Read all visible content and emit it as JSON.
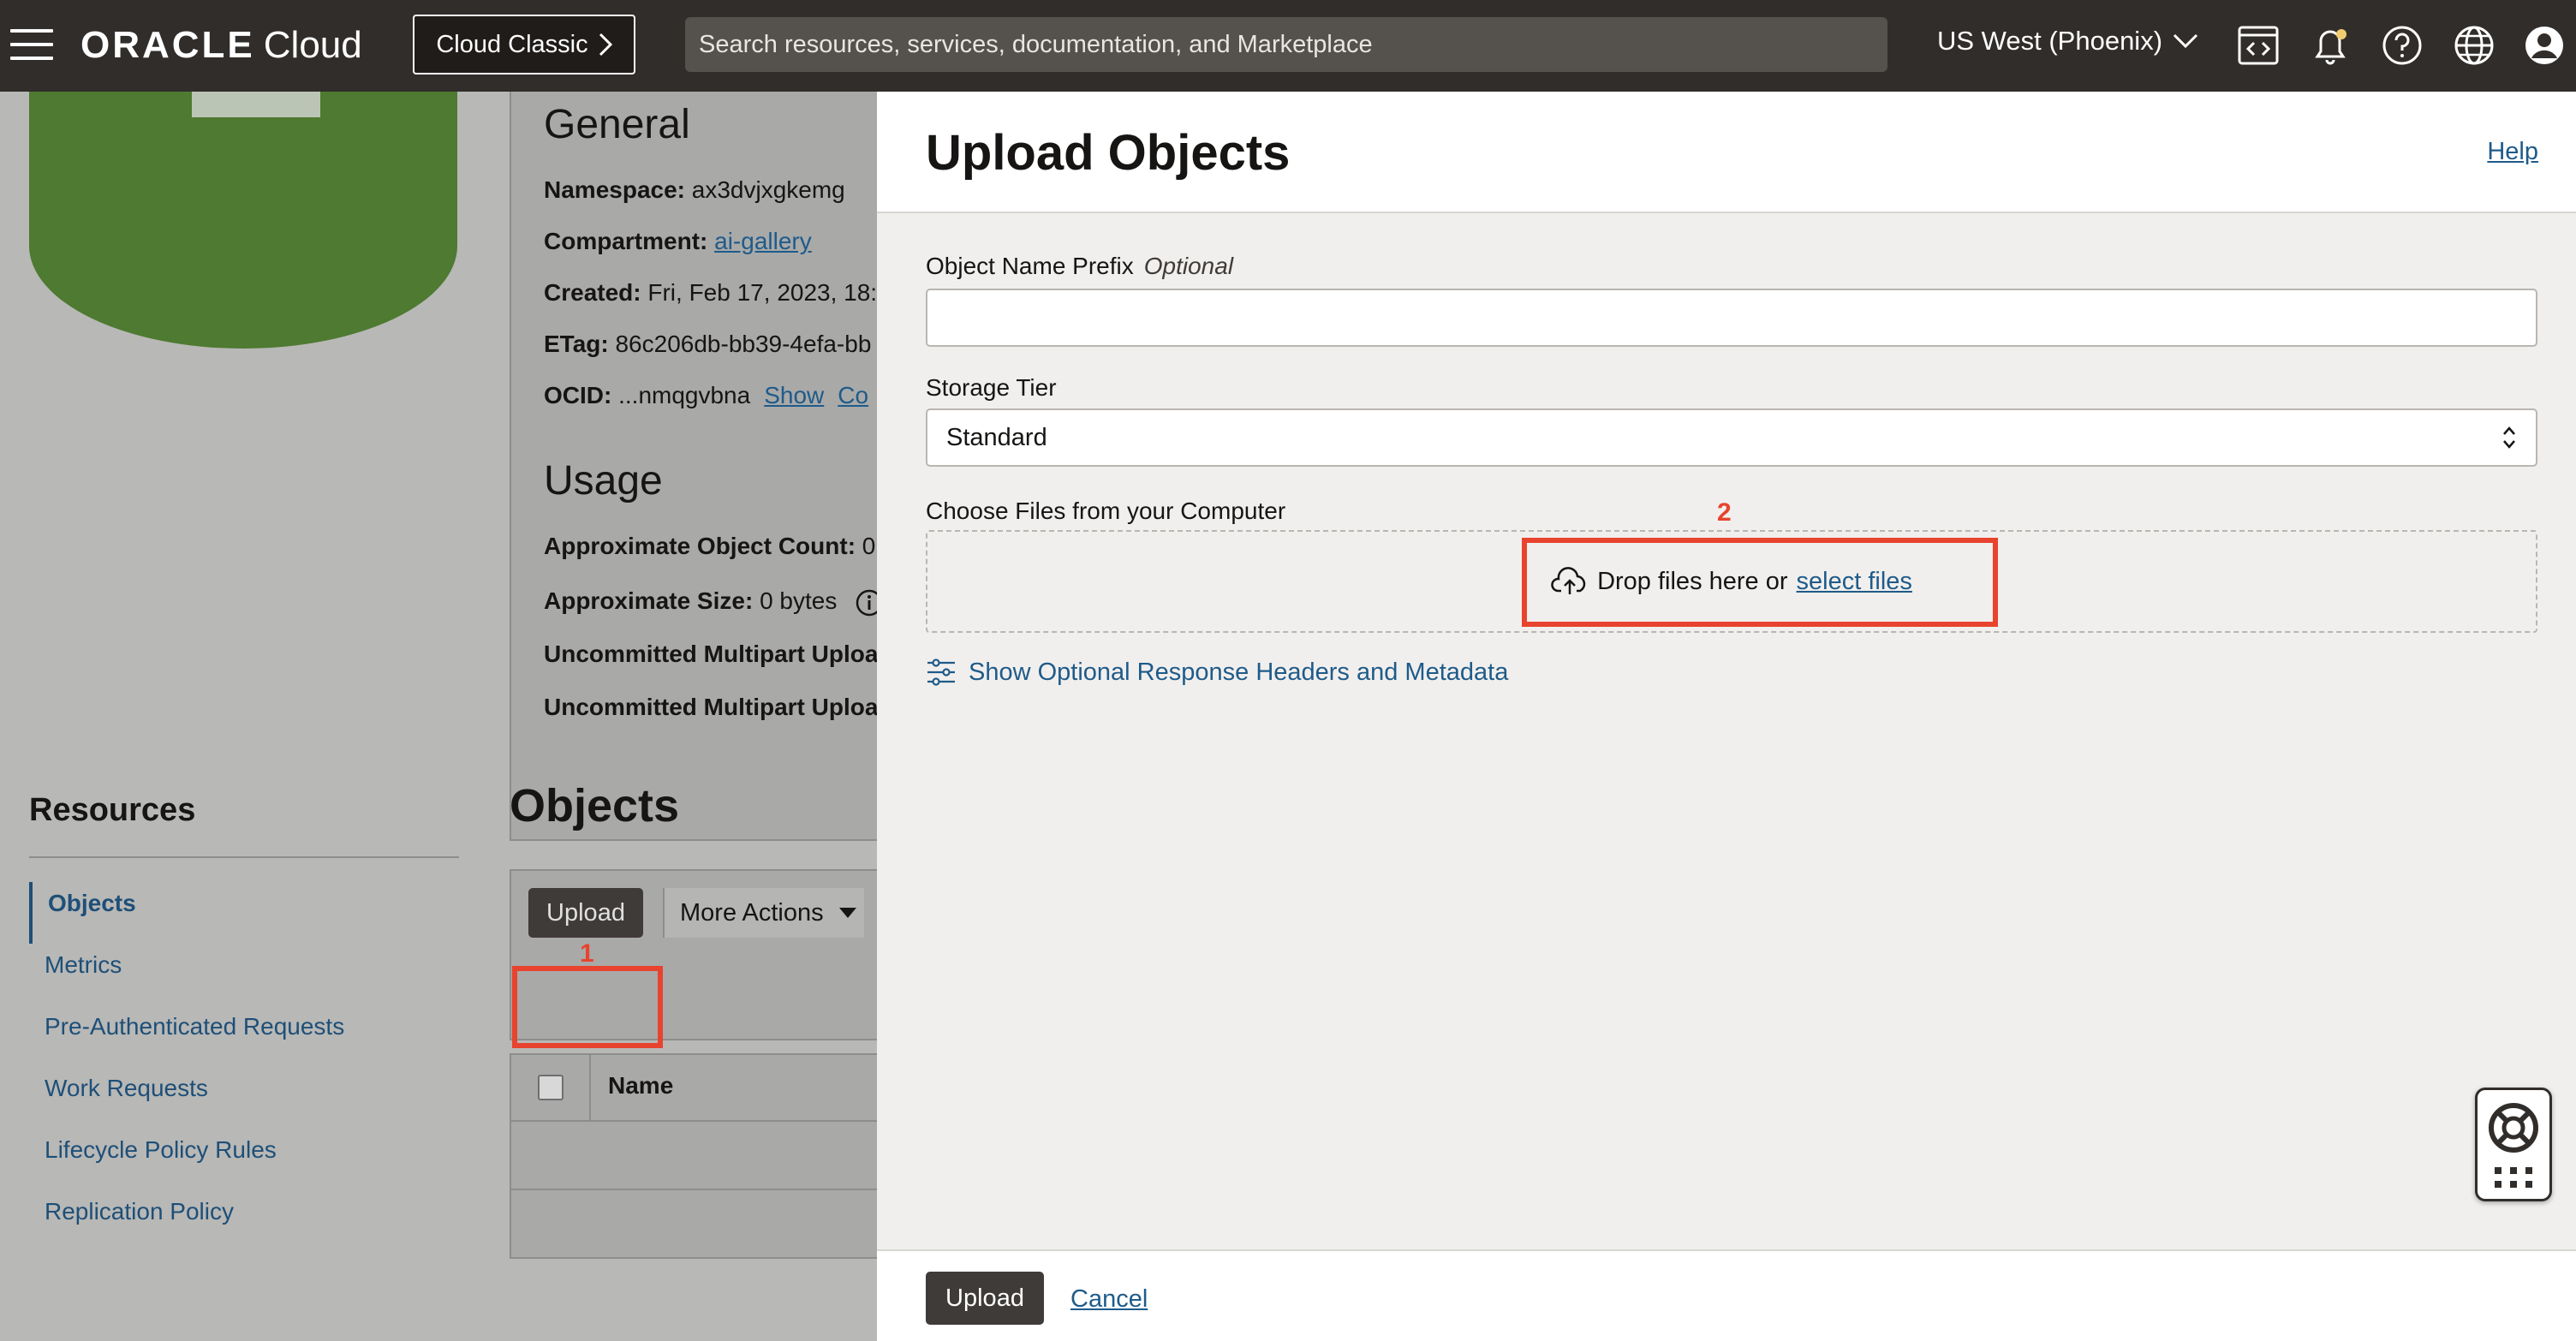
{
  "topbar": {
    "brand_oracle": "ORACLE",
    "brand_cloud": "Cloud",
    "classic_button": "Cloud Classic",
    "search_placeholder": "Search resources, services, documentation, and Marketplace",
    "region": "US West (Phoenix)"
  },
  "bucket_details": {
    "general_title": "General",
    "namespace_label": "Namespace:",
    "namespace_value": "ax3dvjxgkemg",
    "compartment_label": "Compartment:",
    "compartment_value": "ai-gallery",
    "created_label": "Created:",
    "created_value": "Fri, Feb 17, 2023, 18:",
    "etag_label": "ETag:",
    "etag_value": "86c206db-bb39-4efa-bb",
    "ocid_label": "OCID:",
    "ocid_value": "...nmqgvbna",
    "ocid_show": "Show",
    "ocid_copy": "Co",
    "usage_title": "Usage",
    "object_count_label": "Approximate Object Count:",
    "object_count_value": "0",
    "size_label": "Approximate Size:",
    "size_value": "0 bytes",
    "multipart1_label": "Uncommitted Multipart Uploa",
    "multipart2_label": "Uncommitted Multipart Uploa"
  },
  "resources": {
    "title": "Resources",
    "items": [
      {
        "label": "Objects",
        "active": true
      },
      {
        "label": "Metrics",
        "active": false
      },
      {
        "label": "Pre-Authenticated Requests",
        "active": false
      },
      {
        "label": "Work Requests",
        "active": false
      },
      {
        "label": "Lifecycle Policy Rules",
        "active": false
      },
      {
        "label": "Replication Policy",
        "active": false
      }
    ]
  },
  "objects": {
    "title": "Objects",
    "upload_button": "Upload",
    "more_actions": "More Actions",
    "name_column": "Name"
  },
  "annotations": {
    "step1": "1",
    "step2": "2",
    "color": "#e8432e"
  },
  "drawer": {
    "title": "Upload Objects",
    "help": "Help",
    "prefix_label": "Object Name Prefix",
    "prefix_optional": "Optional",
    "prefix_value": "",
    "tier_label": "Storage Tier",
    "tier_value": "Standard",
    "choose_label": "Choose Files from your Computer",
    "drop_text": "Drop files here or",
    "select_files": "select files",
    "optional_headers": "Show Optional Response Headers and Metadata",
    "upload_button": "Upload",
    "cancel": "Cancel"
  },
  "colors": {
    "topbar": "#312d2a",
    "link": "#1e5b8a",
    "bucket_green": "#4a7a2c"
  }
}
